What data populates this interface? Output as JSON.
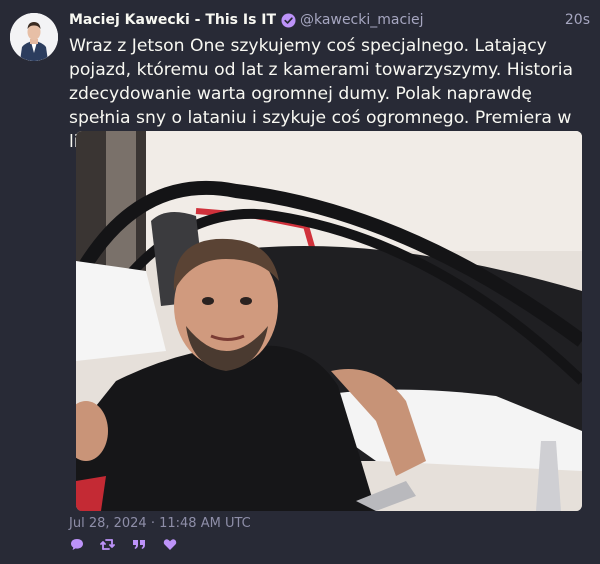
{
  "tweet": {
    "fullname": "Maciej Kawecki - This Is IT",
    "username": "@kawecki_maciej",
    "time": "20s",
    "text": "Wraz z Jetson One szykujemy coś specjalnego. Latający pojazd, któremu od lat z kamerami towarzyszymy. Historia zdecydowanie warta ogromnej dumy. Polak naprawdę spełnia sny o lataniu i szykuje coś ogromnego. Premiera w listopadzie.",
    "date": "Jul 28, 2024 · 11:48 AM UTC"
  },
  "colors": {
    "background": "#282a36",
    "accent": "#bd93f9",
    "text": "#f8f8f2",
    "muted": "#a6a6c0"
  },
  "icons": {
    "verified": "verified-badge-icon",
    "reply": "comment-icon",
    "retweet": "retweet-icon",
    "quote": "quote-icon",
    "like": "heart-icon"
  }
}
